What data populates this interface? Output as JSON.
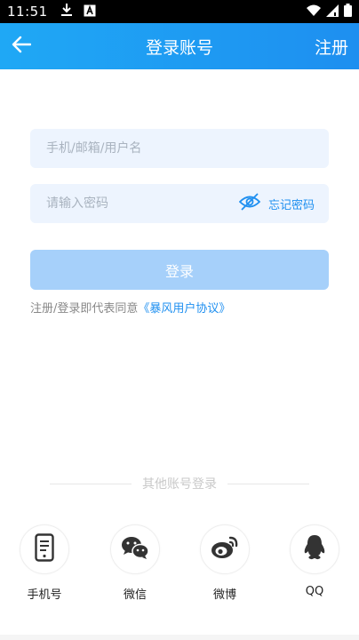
{
  "status_bar": {
    "time": "11:51",
    "icons_left": [
      "download-icon",
      "a-badge-icon"
    ],
    "icons_right": [
      "wifi-icon",
      "signal-icon",
      "battery-icon"
    ]
  },
  "header": {
    "title": "登录账号",
    "right_action": "注册",
    "back_icon": "back-arrow-icon",
    "gradient_colors": [
      "#1fa8f5",
      "#1e8ff0"
    ]
  },
  "form": {
    "username_placeholder": "手机/邮箱/用户名",
    "password_placeholder": "请输入密码",
    "eye_icon": "eye-off-icon",
    "forgot_password": "忘记密码",
    "login_button": "登录",
    "agreement_text": "注册/登录即代表同意",
    "agreement_link": "《暴风用户协议》"
  },
  "other_login": {
    "title": "其他账号登录",
    "items": [
      {
        "label": "手机号",
        "icon": "phone-icon"
      },
      {
        "label": "微信",
        "icon": "wechat-icon"
      },
      {
        "label": "微博",
        "icon": "weibo-icon"
      },
      {
        "label": "QQ",
        "icon": "qq-icon"
      }
    ]
  },
  "colors": {
    "accent": "#1e8ff0",
    "field_bg": "#edf4fe",
    "login_button_bg": "#a6d0fa"
  }
}
